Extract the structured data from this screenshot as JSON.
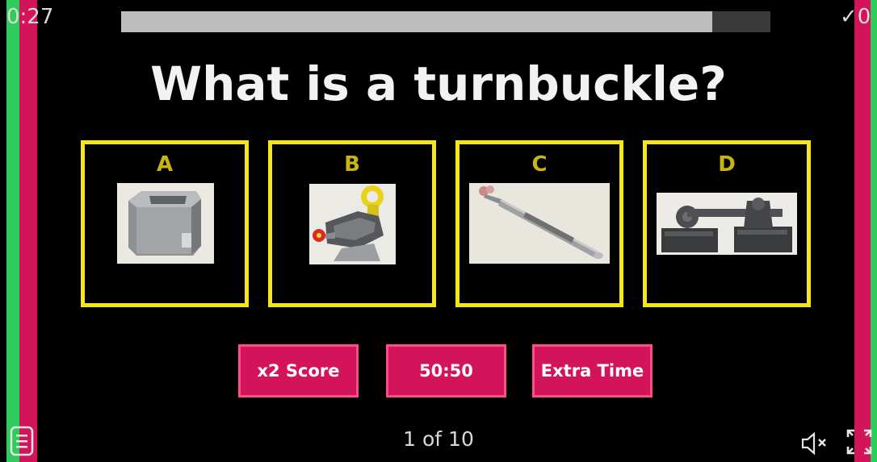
{
  "hud": {
    "timer": "0:27",
    "progress_fraction": 0.91,
    "score": "✓0"
  },
  "question": {
    "text": "What is a turnbuckle?"
  },
  "options": [
    {
      "letter": "A",
      "icon": "square-fitting-image"
    },
    {
      "letter": "B",
      "icon": "clamp-fitting-image"
    },
    {
      "letter": "C",
      "icon": "rod-turnbuckle-image"
    },
    {
      "letter": "D",
      "icon": "hinged-clamp-image"
    }
  ],
  "lifelines": [
    {
      "label": "x2 Score"
    },
    {
      "label": "50:50"
    },
    {
      "label": "Extra Time"
    }
  ],
  "footer": {
    "counter": "1 of 10",
    "menu_icon": "menu-icon",
    "mute_icon": "mute-icon",
    "fullscreen_icon": "fullscreen-icon"
  },
  "colors": {
    "accent_pink": "#d4145a",
    "accent_green": "#2ecc5a",
    "option_border": "#f5e61a",
    "letter": "#c9b512"
  }
}
